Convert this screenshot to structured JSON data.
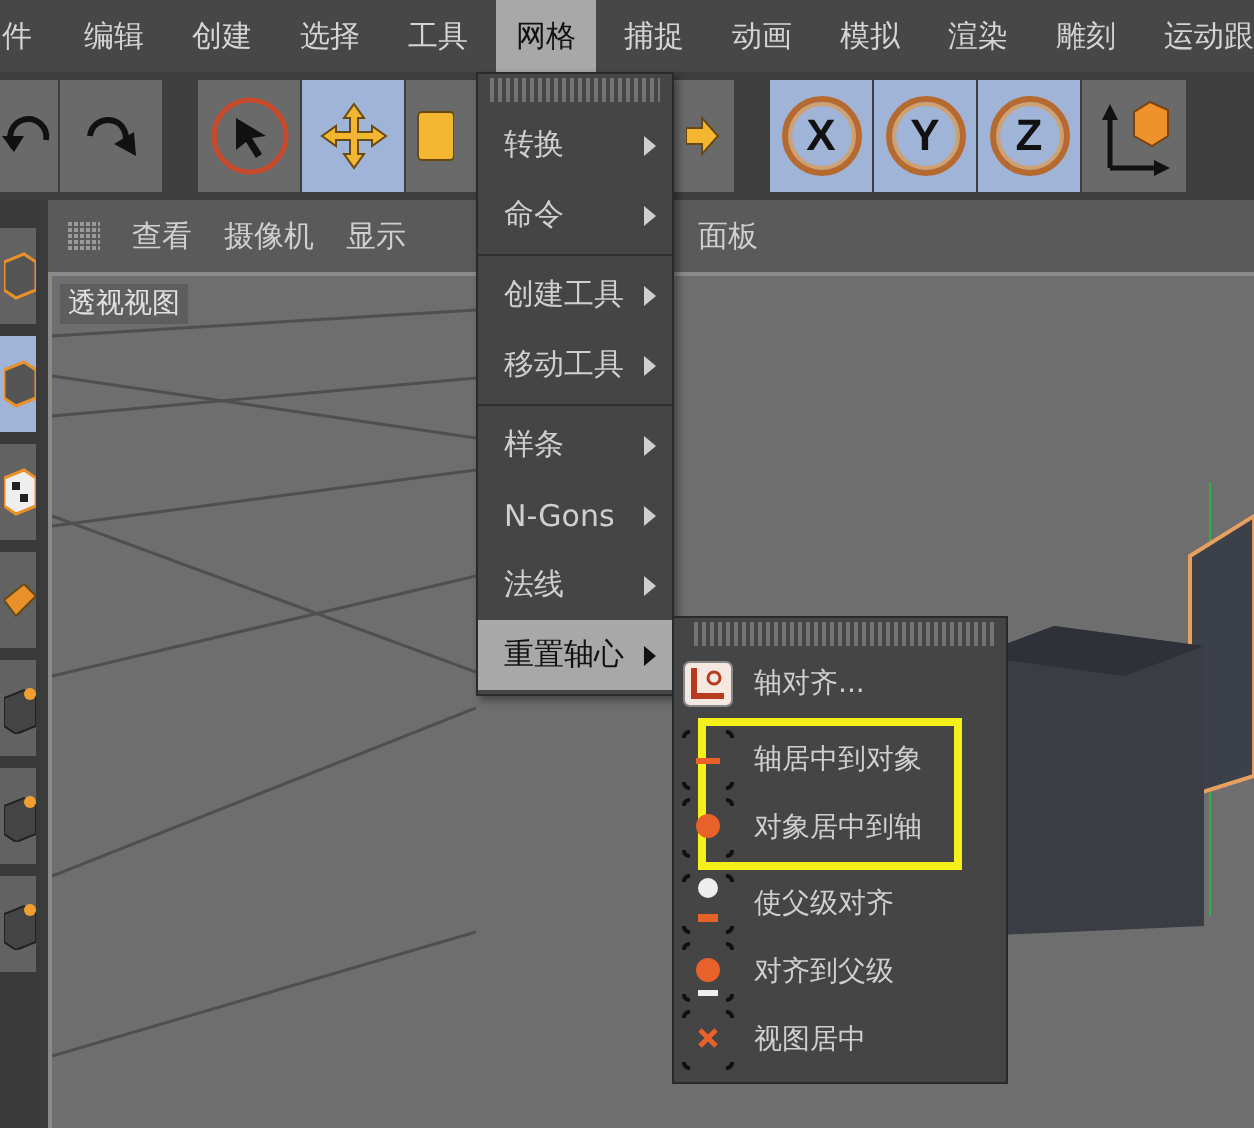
{
  "menu_bar": {
    "items": [
      {
        "label": "件",
        "selected": false
      },
      {
        "label": "编辑",
        "selected": false
      },
      {
        "label": "创建",
        "selected": false
      },
      {
        "label": "选择",
        "selected": false
      },
      {
        "label": "工具",
        "selected": false
      },
      {
        "label": "网格",
        "selected": true
      },
      {
        "label": "捕捉",
        "selected": false
      },
      {
        "label": "动画",
        "selected": false
      },
      {
        "label": "模拟",
        "selected": false
      },
      {
        "label": "渲染",
        "selected": false
      },
      {
        "label": "雕刻",
        "selected": false
      },
      {
        "label": "运动跟",
        "selected": false
      }
    ]
  },
  "toolbar": {
    "tools": [
      {
        "kind": "undo",
        "selected": false
      },
      {
        "kind": "redo",
        "selected": false
      },
      {
        "kind": "select",
        "selected": false
      },
      {
        "kind": "move",
        "selected": true
      },
      {
        "kind": "scale",
        "selected": false
      },
      {
        "kind": "rotate"
      },
      {
        "kind": "axis",
        "label": "X",
        "selected": true
      },
      {
        "kind": "axis",
        "label": "Y",
        "selected": true
      },
      {
        "kind": "axis",
        "label": "Z",
        "selected": true
      },
      {
        "kind": "coords",
        "selected": false
      }
    ]
  },
  "left_toolbar": {
    "tools": [
      {
        "kind": "cube",
        "selected": false
      },
      {
        "kind": "cube",
        "selected": true
      },
      {
        "kind": "checker",
        "selected": false
      },
      {
        "kind": "plane",
        "selected": false
      },
      {
        "kind": "point",
        "selected": false
      },
      {
        "kind": "edge",
        "selected": false
      },
      {
        "kind": "poly",
        "selected": false
      }
    ]
  },
  "viewport": {
    "menu": [
      "查看",
      "摄像机",
      "显示",
      "面板"
    ],
    "title": "透视视图"
  },
  "mesh_menu": {
    "sections": [
      {
        "items": [
          {
            "label": "转换",
            "selected": false
          },
          {
            "label": "命令",
            "selected": false
          }
        ]
      },
      {
        "items": [
          {
            "label": "创建工具",
            "selected": false
          },
          {
            "label": "移动工具",
            "selected": false
          }
        ]
      },
      {
        "items": [
          {
            "label": "样条",
            "selected": false
          },
          {
            "label": "N-Gons",
            "selected": false
          },
          {
            "label": "法线",
            "selected": false
          },
          {
            "label": "重置轴心",
            "selected": true
          }
        ]
      }
    ]
  },
  "axis_submenu": {
    "items": [
      {
        "label": "轴对齐...",
        "kind": "align",
        "highlighted": false
      },
      {
        "label": "轴居中到对象",
        "kind": "axis-to-object",
        "highlighted": true
      },
      {
        "label": "对象居中到轴",
        "kind": "object-to-axis",
        "highlighted": true
      },
      {
        "label": "使父级对齐",
        "kind": "parent-align",
        "highlighted": false
      },
      {
        "label": "对齐到父级",
        "kind": "to-parent",
        "highlighted": false
      },
      {
        "label": "视图居中",
        "kind": "view-center",
        "highlighted": false
      }
    ]
  }
}
